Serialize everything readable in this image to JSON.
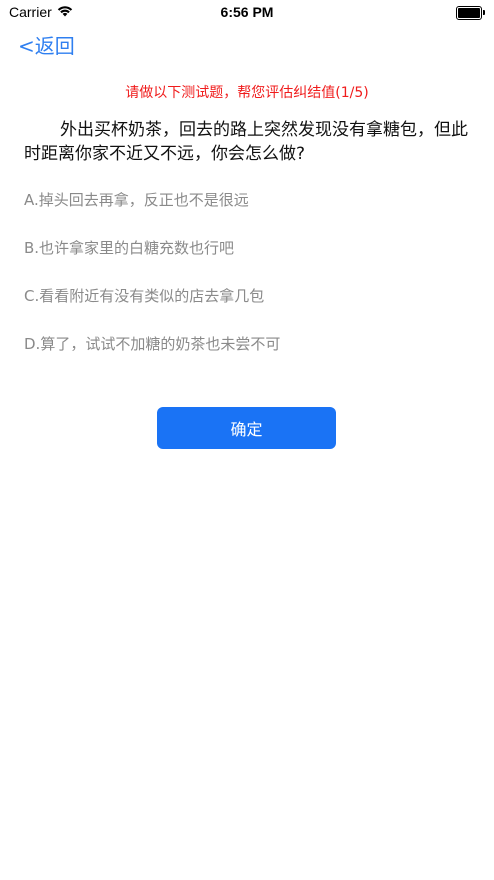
{
  "status_bar": {
    "carrier": "Carrier",
    "time": "6:56 PM",
    "wifi_icon": "wifi-icon",
    "battery_icon": "battery-icon"
  },
  "nav": {
    "back_label": "<返回"
  },
  "quiz": {
    "subtitle": "请做以下测试题，帮您评估纠结值(1/5)",
    "question": "外出买杯奶茶，回去的路上突然发现没有拿糖包，但此时距离你家不近又不远，你会怎么做?",
    "options": [
      "A.掉头回去再拿，反正也不是很远",
      "B.也许拿家里的白糖充数也行吧",
      "C.看看附近有没有类似的店去拿几包",
      "D.算了，试试不加糖的奶茶也未尝不可"
    ],
    "confirm_label": "确定"
  },
  "colors": {
    "accent": "#1a73f5",
    "back_link": "#2f7ff0",
    "subtitle_red": "#f01c1c",
    "option_gray": "#8a8a8a"
  }
}
